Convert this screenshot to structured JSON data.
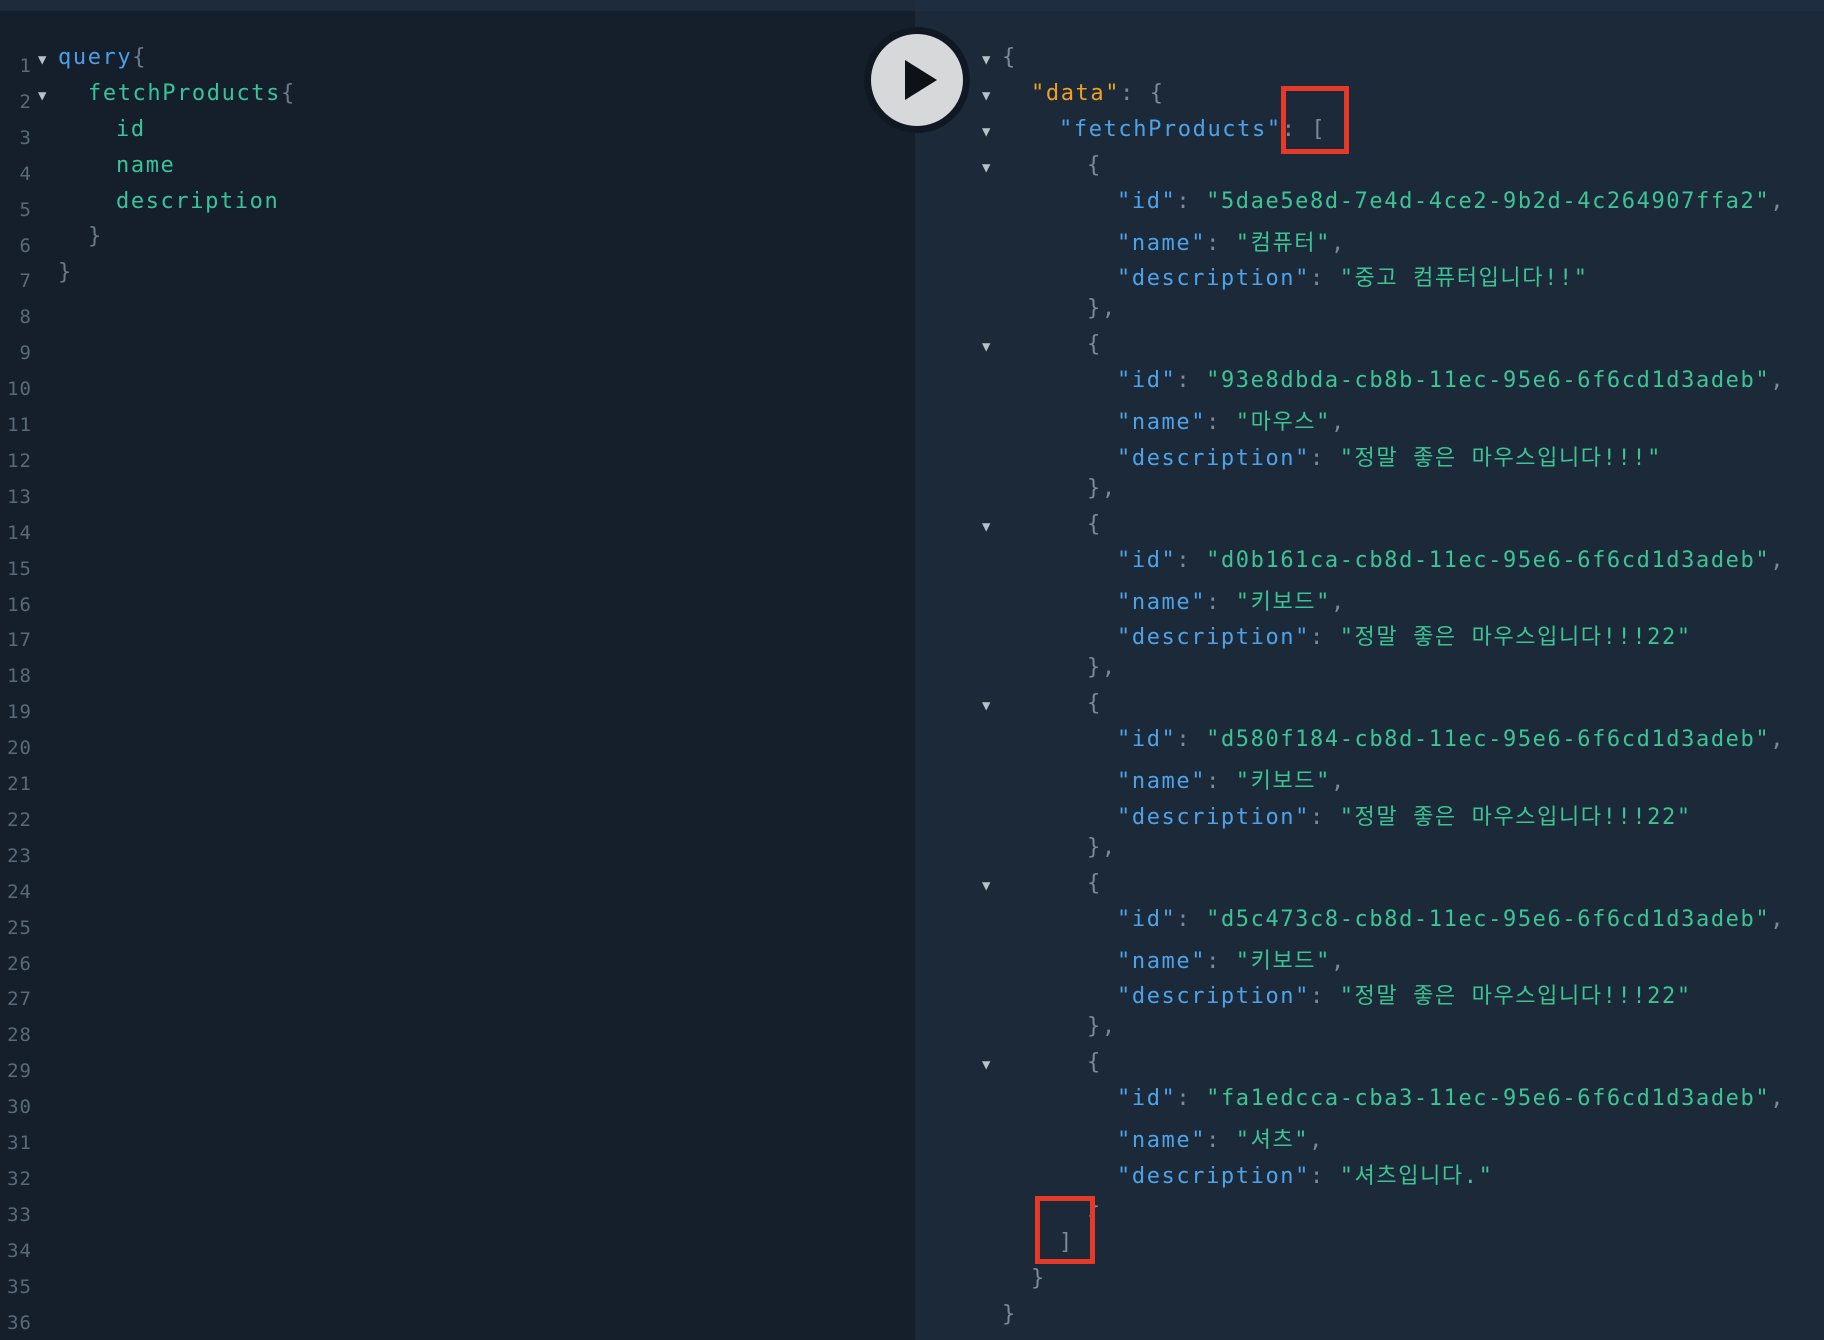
{
  "query_editor": {
    "line_numbers": [
      "1",
      "2",
      "3",
      "4",
      "5",
      "6",
      "7",
      "8",
      "9",
      "10",
      "11",
      "12",
      "13",
      "14",
      "15",
      "16",
      "17",
      "18",
      "19",
      "20",
      "21",
      "22",
      "23",
      "24",
      "25",
      "26",
      "27",
      "28",
      "29",
      "30",
      "31",
      "32",
      "33",
      "34",
      "35",
      "36"
    ],
    "lines": {
      "l1_kw": "query",
      "l1_brace": "{",
      "l2_field": "fetchProducts",
      "l2_brace": "{",
      "l3": "id",
      "l4": "name",
      "l5": "description",
      "l6": "}",
      "l7": "}"
    },
    "fold_icon": "triangle-down"
  },
  "run_button": {
    "icon": "play-icon"
  },
  "result": {
    "open_brace": "{",
    "data_key": "\"data\"",
    "fetch_key": "\"fetchProducts\"",
    "open_bracket": "[",
    "close_bracket": "]",
    "id_key": "\"id\"",
    "name_key": "\"name\"",
    "desc_key": "\"description\"",
    "products": [
      {
        "id": "\"5dae5e8d-7e4d-4ce2-9b2d-4c264907ffa2\"",
        "name": "\"컴퓨터\"",
        "description": "\"중고 컴퓨터입니다!!\""
      },
      {
        "id": "\"93e8dbda-cb8b-11ec-95e6-6f6cd1d3adeb\"",
        "name": "\"마우스\"",
        "description": "\"정말 좋은 마우스입니다!!!\""
      },
      {
        "id": "\"d0b161ca-cb8d-11ec-95e6-6f6cd1d3adeb\"",
        "name": "\"키보드\"",
        "description": "\"정말 좋은 마우스입니다!!!22\""
      },
      {
        "id": "\"d580f184-cb8d-11ec-95e6-6f6cd1d3adeb\"",
        "name": "\"키보드\"",
        "description": "\"정말 좋은 마우스입니다!!!22\""
      },
      {
        "id": "\"d5c473c8-cb8d-11ec-95e6-6f6cd1d3adeb\"",
        "name": "\"키보드\"",
        "description": "\"정말 좋은 마우스입니다!!!22\""
      },
      {
        "id": "\"fa1edcca-cba3-11ec-95e6-6f6cd1d3adeb\"",
        "name": "\"셔츠\"",
        "description": "\"셔츠입니다.\""
      }
    ]
  },
  "colors": {
    "accent_highlight": "#e53a28",
    "keyword": "#4e9de6",
    "field": "#37c49c",
    "data_key": "#f0a024"
  }
}
